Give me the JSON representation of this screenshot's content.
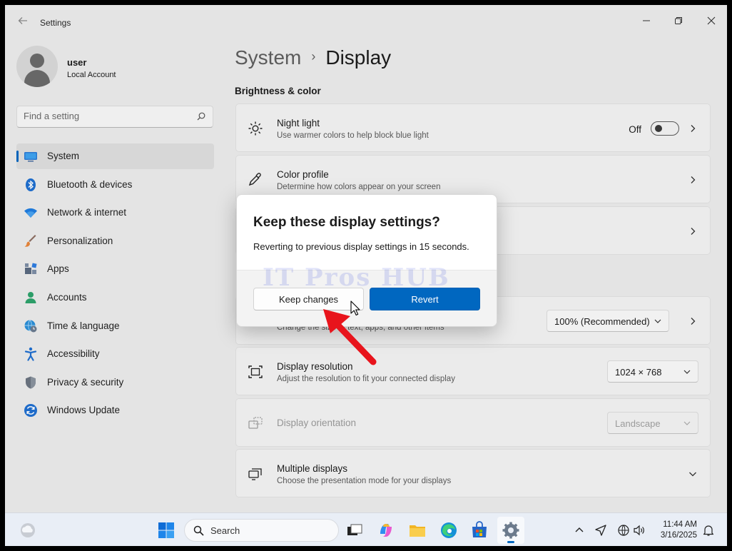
{
  "window": {
    "title": "Settings"
  },
  "profile": {
    "name": "user",
    "account_type": "Local Account"
  },
  "search": {
    "placeholder": "Find a setting"
  },
  "nav": {
    "items": [
      {
        "label": "System",
        "icon": "monitor-icon",
        "active": true
      },
      {
        "label": "Bluetooth & devices",
        "icon": "bluetooth-icon"
      },
      {
        "label": "Network & internet",
        "icon": "wifi-icon"
      },
      {
        "label": "Personalization",
        "icon": "brush-icon"
      },
      {
        "label": "Apps",
        "icon": "apps-icon"
      },
      {
        "label": "Accounts",
        "icon": "person-icon"
      },
      {
        "label": "Time & language",
        "icon": "globe-clock-icon"
      },
      {
        "label": "Accessibility",
        "icon": "accessibility-icon"
      },
      {
        "label": "Privacy & security",
        "icon": "shield-icon"
      },
      {
        "label": "Windows Update",
        "icon": "update-icon"
      }
    ]
  },
  "breadcrumb": {
    "parent": "System",
    "separator": "›",
    "current": "Display"
  },
  "section": {
    "brightness": "Brightness & color"
  },
  "cards": {
    "night_light": {
      "title": "Night light",
      "desc": "Use warmer colors to help block blue light",
      "state": "Off"
    },
    "color_profile": {
      "title": "Color profile",
      "desc": "Determine how colors appear on your screen"
    },
    "scale": {
      "desc": "Change the size of text, apps, and other items",
      "value": "100% (Recommended)"
    },
    "resolution": {
      "title": "Display resolution",
      "desc": "Adjust the resolution to fit your connected display",
      "value": "1024 × 768"
    },
    "orientation": {
      "title": "Display orientation",
      "value": "Landscape"
    },
    "multiple": {
      "title": "Multiple displays",
      "desc": "Choose the presentation mode for your displays"
    }
  },
  "dialog": {
    "title": "Keep these display settings?",
    "message": "Reverting to previous display settings in 15 seconds.",
    "keep_label": "Keep changes",
    "revert_label": "Revert",
    "watermark": "IT Pros HUB"
  },
  "taskbar": {
    "search_label": "Search",
    "time": "11:44 AM",
    "date": "3/16/2025"
  },
  "colors": {
    "accent": "#0067c0",
    "arrow": "#e8141c"
  }
}
